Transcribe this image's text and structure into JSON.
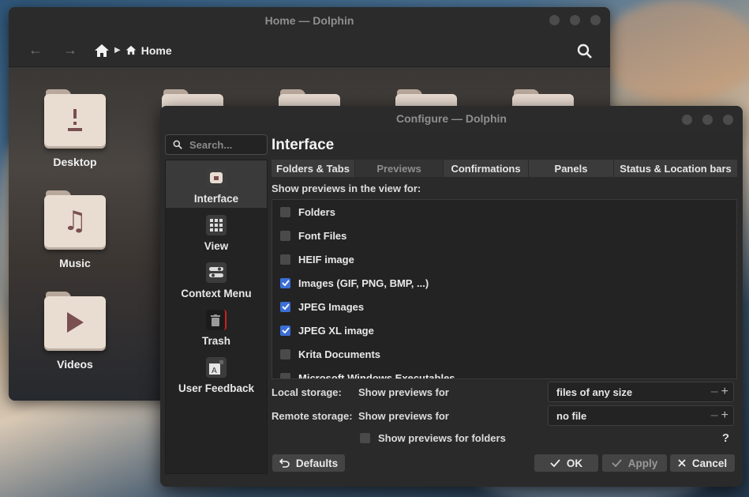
{
  "back_window": {
    "title": "Home — Dolphin",
    "breadcrumb_label": "Home",
    "places": [
      {
        "label": "Desktop",
        "icon": "desktop-folder-icon"
      },
      {
        "label": "Music",
        "icon": "music-folder-icon"
      },
      {
        "label": "Videos",
        "icon": "video-folder-icon"
      }
    ]
  },
  "dialog": {
    "title": "Configure — Dolphin",
    "search_placeholder": "Search...",
    "sidebar": [
      {
        "label": "Interface",
        "icon": "interface-icon",
        "active": true
      },
      {
        "label": "View",
        "icon": "grid-icon",
        "active": false
      },
      {
        "label": "Context Menu",
        "icon": "toggle-icon",
        "active": false
      },
      {
        "label": "Trash",
        "icon": "trash-icon",
        "active": false
      },
      {
        "label": "User Feedback",
        "icon": "feedback-icon",
        "active": false
      }
    ],
    "page_title": "Interface",
    "tabs": [
      {
        "label": "Folders & Tabs",
        "selected": false
      },
      {
        "label": "Previews",
        "selected": true
      },
      {
        "label": "Confirmations",
        "selected": false
      },
      {
        "label": "Panels",
        "selected": false
      },
      {
        "label": "Status & Location bars",
        "selected": false
      }
    ],
    "previews_label": "Show previews in the view for:",
    "preview_types": [
      {
        "label": "Folders",
        "checked": false
      },
      {
        "label": "Font Files",
        "checked": false
      },
      {
        "label": "HEIF image",
        "checked": false
      },
      {
        "label": "Images (GIF, PNG, BMP, ...)",
        "checked": true
      },
      {
        "label": "JPEG Images",
        "checked": true
      },
      {
        "label": "JPEG XL image",
        "checked": true
      },
      {
        "label": "Krita Documents",
        "checked": false
      },
      {
        "label": "Microsoft Windows Executables",
        "checked": false
      }
    ],
    "local_storage": {
      "label": "Local storage:",
      "sub": "Show previews for",
      "value": "files of any size"
    },
    "remote_storage": {
      "label": "Remote storage:",
      "sub": "Show previews for",
      "value": "no file"
    },
    "show_folders_label": "Show previews for folders",
    "help_label": "?",
    "buttons": {
      "defaults": "Defaults",
      "ok": "OK",
      "apply": "Apply",
      "cancel": "Cancel"
    },
    "accent": "#3b6fd8"
  }
}
